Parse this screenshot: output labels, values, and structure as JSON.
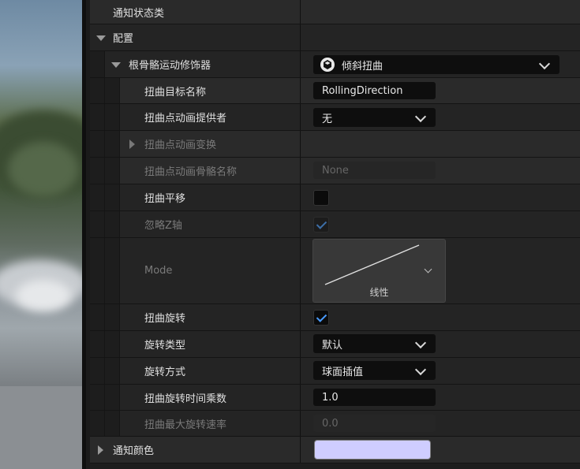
{
  "rows": {
    "notify_state_class": "通知状态类",
    "config": "配置",
    "root_motion_modifier": "根骨骼运动修饰器",
    "root_motion_modifier_value": "倾斜扭曲",
    "warp_target_name": "扭曲目标名称",
    "warp_target_name_value": "RollingDirection",
    "warp_point_anim_provider": "扭曲点动画提供者",
    "warp_point_anim_provider_value": "无",
    "warp_point_anim_transform": "扭曲点动画变换",
    "warp_point_anim_bone_name": "扭曲点动画骨骼名称",
    "warp_point_anim_bone_name_placeholder": "None",
    "warp_translation": "扭曲平移",
    "ignore_z_axis": "忽略Z轴",
    "mode": "Mode",
    "mode_value": "线性",
    "warp_rotation": "扭曲旋转",
    "rotation_type": "旋转类型",
    "rotation_type_value": "默认",
    "rotation_method": "旋转方式",
    "rotation_method_value": "球面插值",
    "warp_rotation_time_multiplier": "扭曲旋转时间乘数",
    "warp_rotation_time_multiplier_value": "1.0",
    "warp_max_rotation_speed": "扭曲最大旋转速率",
    "warp_max_rotation_speed_value": "0.0",
    "notify_color": "通知颜色"
  },
  "state": {
    "warp_translation_checked": false,
    "ignore_z_axis_checked": true,
    "warp_rotation_checked": true
  },
  "colors": {
    "notify_color": "#cfcdff",
    "accent": "#4a9cff"
  },
  "icons": {
    "modifier_icon": "ue-class-icon",
    "expand": "caret-down-icon",
    "collapse": "caret-right-icon"
  }
}
